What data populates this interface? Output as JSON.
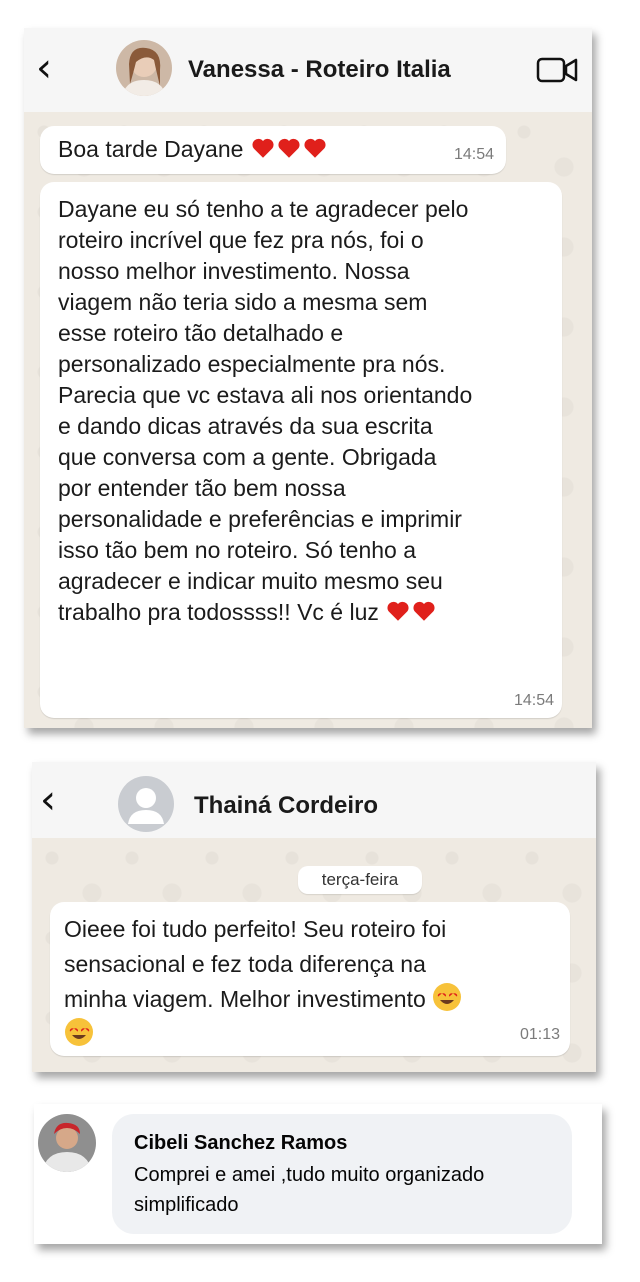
{
  "chat1": {
    "contact_name": "Vanessa - Roteiro Italia",
    "messages": [
      {
        "text": "Boa tarde Dayane",
        "time": "14:54"
      },
      {
        "lines": [
          "Dayane eu só tenho a te agradecer pelo",
          "roteiro incrível que fez pra nós, foi o",
          "nosso melhor investimento. Nossa",
          "viagem não teria sido a mesma sem",
          "esse roteiro tão detalhado e",
          "personalizado especialmente pra nós.",
          "Parecia que vc estava ali nos orientando",
          "e dando dicas através da sua escrita",
          "que conversa com a gente. Obrigada",
          "por entender tão bem nossa",
          "personalidade e preferências e imprimir",
          "isso tão bem no roteiro. Só tenho a",
          "agradecer e indicar muito mesmo seu",
          "trabalho pra todossss!! Vc é luz"
        ],
        "time": "14:54"
      }
    ]
  },
  "chat2": {
    "contact_name": "Thainá Cordeiro",
    "date_divider": "terça-feira",
    "message": {
      "lines": [
        "Oieee foi tudo perfeito! Seu roteiro foi",
        "sensacional e fez toda diferença na",
        "minha viagem. Melhor investimento"
      ],
      "time": "01:13"
    }
  },
  "comment": {
    "author": "Cibeli Sanchez Ramos",
    "lines": [
      "Comprei e amei ,tudo muito organizado",
      "simplificado"
    ]
  },
  "icons": {
    "back": "chevron-left-icon",
    "video": "video-camera-icon",
    "heart": "red-heart-emoji",
    "heart_eyes": "heart-eyes-emoji"
  },
  "colors": {
    "heart": "#e0201b",
    "emoji_face": "#f7c23a",
    "chat_wallpaper": "#efeae2",
    "comment_bg": "#f0f2f5"
  }
}
